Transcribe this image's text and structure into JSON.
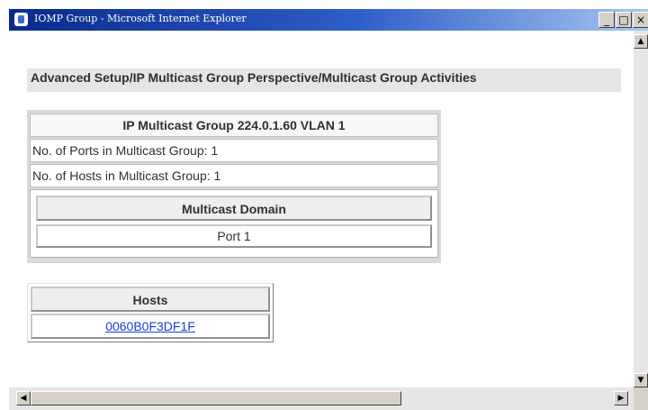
{
  "window": {
    "title": "IOMP Group - Microsoft Internet Explorer",
    "controls": {
      "minimize": "_",
      "maximize": "□",
      "close": "×"
    }
  },
  "page": {
    "heading": "Advanced Setup/IP Multicast Group Perspective/Multicast Group Activities"
  },
  "group": {
    "title": "IP Multicast Group 224.0.1.60 VLAN 1",
    "ports_line": "No. of Ports in Multicast Group: 1",
    "hosts_line": "No. of Hosts in Multicast Group: 1",
    "domain": {
      "header": "Multicast Domain",
      "value": "Port 1"
    }
  },
  "hosts_table": {
    "header": "Hosts",
    "items": [
      "0060B0F3DF1F"
    ]
  },
  "scrollbar": {
    "up_arrow": "▲",
    "down_arrow": "▼",
    "left_arrow": "◀",
    "right_arrow": "▶"
  },
  "icons": {
    "app": "ie-page-icon"
  }
}
